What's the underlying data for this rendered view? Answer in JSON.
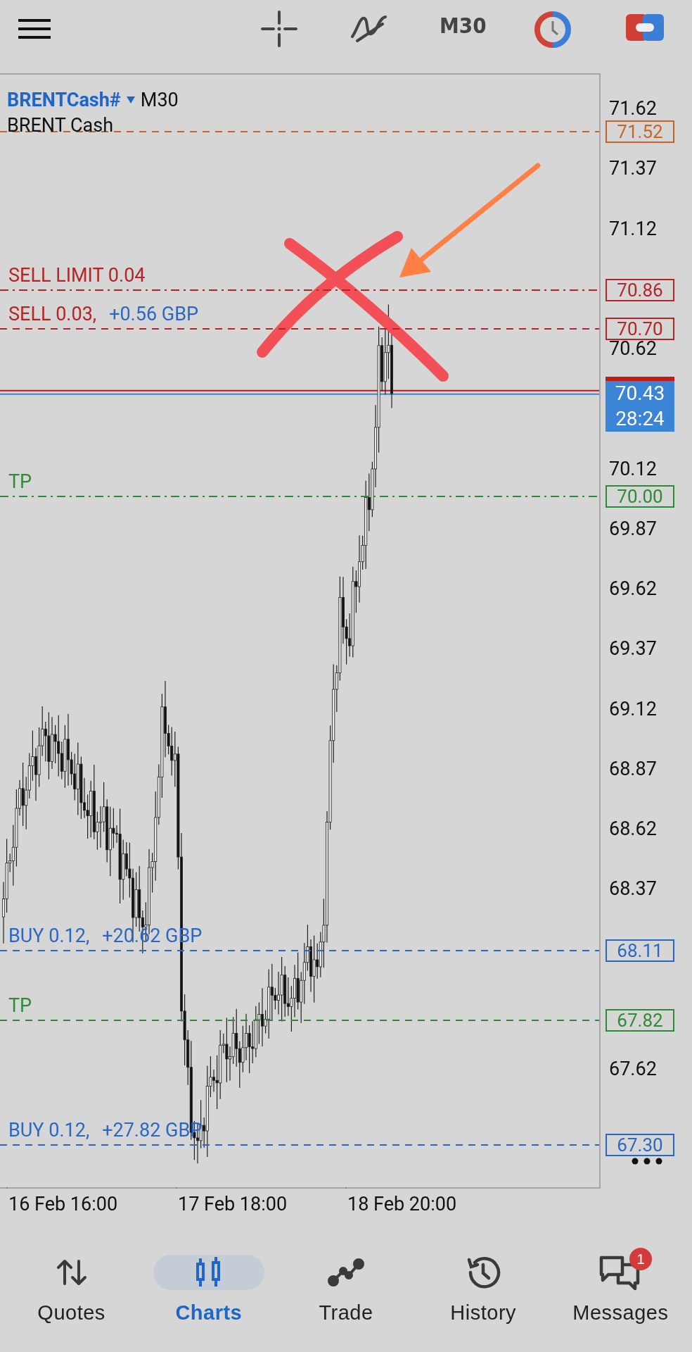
{
  "toolbar": {
    "timeframe": "M30"
  },
  "chart": {
    "symbol": "BRENTCash#",
    "timeframe": "M30",
    "description": "BRENT Cash",
    "price_axis": [
      "71.62",
      "71.37",
      "71.12",
      "70.62",
      "70.12",
      "69.87",
      "69.62",
      "69.37",
      "69.12",
      "68.87",
      "68.62",
      "68.37",
      "67.62"
    ],
    "levels": [
      {
        "kind": "sl",
        "price": "71.52",
        "color": "#c8642a",
        "pending": false
      },
      {
        "kind": "order",
        "label": "SELL LIMIT 0.04",
        "price": "70.86",
        "color": "#b52525",
        "pending": true
      },
      {
        "kind": "position",
        "label": "SELL 0.03,",
        "profit": "+0.56 GBP",
        "price": "70.70",
        "color": "#b52525",
        "pending": false
      },
      {
        "kind": "tp",
        "label": "TP",
        "price": "70.00",
        "color": "#2e8b35",
        "pending": true
      },
      {
        "kind": "position",
        "label": "BUY 0.12,",
        "profit": "+20.62 GBP",
        "price": "68.11",
        "color": "#2a68c4",
        "pending": false
      },
      {
        "kind": "tp",
        "label": "TP",
        "price": "67.82",
        "color": "#2e8b35",
        "pending": false
      },
      {
        "kind": "position",
        "label": "BUY 0.12,",
        "profit": "+27.82 GBP",
        "price": "67.30",
        "color": "#2a68c4",
        "pending": false
      }
    ],
    "current": {
      "price": "70.43",
      "countdown": "28:24"
    },
    "time_axis": [
      "16 Feb 16:00",
      "17 Feb 18:00",
      "18 Feb 20:00"
    ]
  },
  "nav": [
    {
      "label": "Quotes",
      "selected": false
    },
    {
      "label": "Charts",
      "selected": true
    },
    {
      "label": "Trade",
      "selected": false
    },
    {
      "label": "History",
      "selected": false
    },
    {
      "label": "Messages",
      "selected": false,
      "badge": "1"
    }
  ]
}
